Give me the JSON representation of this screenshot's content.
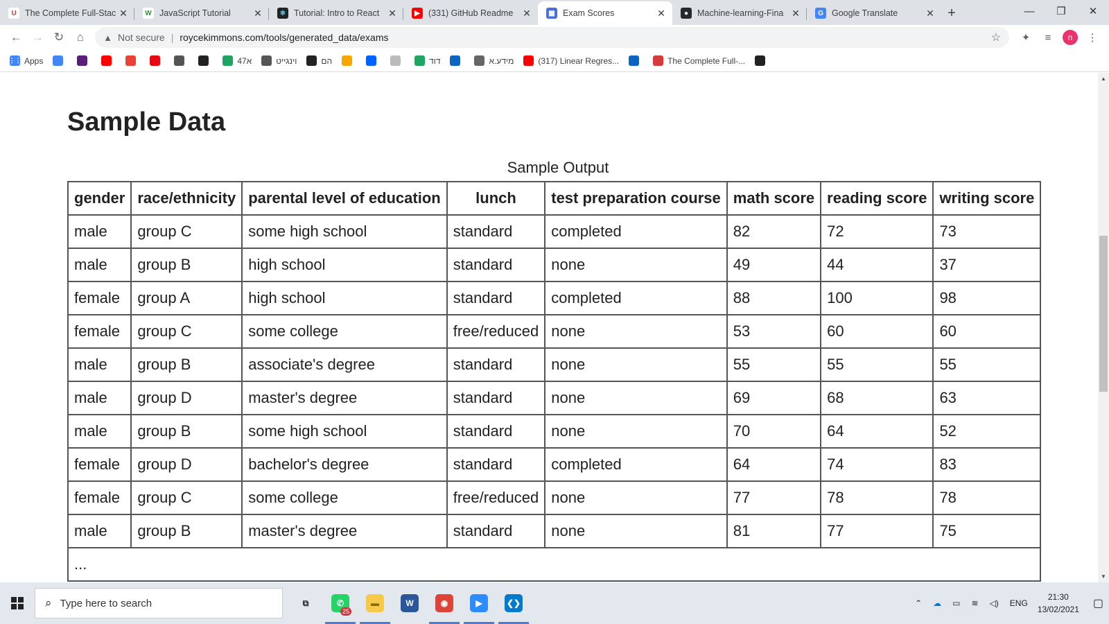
{
  "browser": {
    "tabs": [
      {
        "title": "The Complete Full-Stac",
        "fav": "U",
        "color": "#ffffff",
        "fg": "#d63c3c",
        "active": false
      },
      {
        "title": "JavaScript Tutorial",
        "fav": "W",
        "color": "#ffffff",
        "fg": "#2e8b3a",
        "active": false
      },
      {
        "title": "Tutorial: Intro to React",
        "fav": "⚛",
        "color": "#222222",
        "fg": "#61dafb",
        "active": false
      },
      {
        "title": "(331) GitHub Readme",
        "fav": "▶",
        "color": "#ff0000",
        "fg": "#ffffff",
        "active": false
      },
      {
        "title": "Exam Scores",
        "fav": "▦",
        "color": "#4a6fd6",
        "fg": "#ffffff",
        "active": true
      },
      {
        "title": "Machine-learning-Fina",
        "fav": "●",
        "color": "#24292e",
        "fg": "#ffffff",
        "active": false
      },
      {
        "title": "Google Translate",
        "fav": "G",
        "color": "#4285f4",
        "fg": "#ffffff",
        "active": false
      }
    ],
    "security_label": "Not secure",
    "url": "roycekimmons.com/tools/generated_data/exams",
    "avatar_letter": "n",
    "bookmarks": [
      {
        "label": "Apps",
        "icon": "apps-icon",
        "color": "#4285f4"
      },
      {
        "label": "",
        "icon": "translate-icon",
        "color": "#4285f4"
      },
      {
        "label": "",
        "icon": "app-icon",
        "color": "#5a1d7a"
      },
      {
        "label": "",
        "icon": "youtube-icon",
        "color": "#ff0000"
      },
      {
        "label": "",
        "icon": "google-icon",
        "color": "#ea4335"
      },
      {
        "label": "",
        "icon": "netflix-icon",
        "color": "#e50914"
      },
      {
        "label": "",
        "icon": "globe-icon",
        "color": "#555555"
      },
      {
        "label": "",
        "icon": "x-icon",
        "color": "#222222"
      },
      {
        "label": "47א",
        "icon": "drive-icon",
        "color": "#1fa463"
      },
      {
        "label": "וינגייט",
        "icon": "globe-icon",
        "color": "#555555"
      },
      {
        "label": "הם",
        "icon": "wix-icon",
        "color": "#222222"
      },
      {
        "label": "",
        "icon": "fire-icon",
        "color": "#f6a800"
      },
      {
        "label": "",
        "icon": "dropbox-icon",
        "color": "#0061ff"
      },
      {
        "label": "",
        "icon": "cloud-icon",
        "color": "#bbbbbb"
      },
      {
        "label": "דוד",
        "icon": "drive-icon",
        "color": "#1fa463"
      },
      {
        "label": "",
        "icon": "linkedin-icon",
        "color": "#0a66c2"
      },
      {
        "label": "מידע.א",
        "icon": "app-icon",
        "color": "#666666"
      },
      {
        "label": "(317) Linear Regres...",
        "icon": "youtube-icon",
        "color": "#ff0000"
      },
      {
        "label": "",
        "icon": "linkedin-icon",
        "color": "#0a66c2"
      },
      {
        "label": "The Complete Full-...",
        "icon": "udemy-icon",
        "color": "#d63c3c"
      },
      {
        "label": "",
        "icon": "github-icon",
        "color": "#222222"
      }
    ]
  },
  "page": {
    "title": "Sample Data",
    "caption": "Sample Output",
    "columns": [
      "gender",
      "race/ethnicity",
      "parental level of education",
      "lunch",
      "test preparation course",
      "math score",
      "reading score",
      "writing score"
    ],
    "rows": [
      [
        "male",
        "group C",
        "some high school",
        "standard",
        "completed",
        "82",
        "72",
        "73"
      ],
      [
        "male",
        "group B",
        "high school",
        "standard",
        "none",
        "49",
        "44",
        "37"
      ],
      [
        "female",
        "group A",
        "high school",
        "standard",
        "completed",
        "88",
        "100",
        "98"
      ],
      [
        "female",
        "group C",
        "some college",
        "free/reduced",
        "none",
        "53",
        "60",
        "60"
      ],
      [
        "male",
        "group B",
        "associate's degree",
        "standard",
        "none",
        "55",
        "55",
        "55"
      ],
      [
        "male",
        "group D",
        "master's degree",
        "standard",
        "none",
        "69",
        "68",
        "63"
      ],
      [
        "male",
        "group B",
        "some high school",
        "standard",
        "none",
        "70",
        "64",
        "52"
      ],
      [
        "female",
        "group D",
        "bachelor's degree",
        "standard",
        "completed",
        "64",
        "74",
        "83"
      ],
      [
        "female",
        "group C",
        "some college",
        "free/reduced",
        "none",
        "77",
        "78",
        "78"
      ],
      [
        "male",
        "group B",
        "master's degree",
        "standard",
        "none",
        "81",
        "77",
        "75"
      ]
    ],
    "more_rows": "..."
  },
  "taskbar": {
    "search_placeholder": "Type here to search",
    "apps": [
      {
        "name": "task-view-icon",
        "label": "⧉",
        "color": "#e3e7ee",
        "fg": "#222222",
        "running": false
      },
      {
        "name": "whatsapp-icon",
        "label": "✆",
        "color": "#25d366",
        "fg": "#ffffff",
        "running": true,
        "badge": "25"
      },
      {
        "name": "file-explorer-icon",
        "label": "▬",
        "color": "#f7c948",
        "fg": "#8a6a00",
        "running": true
      },
      {
        "name": "word-icon",
        "label": "W",
        "color": "#2b579a",
        "fg": "#ffffff",
        "running": false
      },
      {
        "name": "chrome-icon",
        "label": "◉",
        "color": "#db4437",
        "fg": "#ffffff",
        "running": true
      },
      {
        "name": "zoom-icon",
        "label": "▶",
        "color": "#2d8cff",
        "fg": "#ffffff",
        "running": true
      },
      {
        "name": "vscode-icon",
        "label": "❮❯",
        "color": "#007acc",
        "fg": "#ffffff",
        "running": true
      }
    ],
    "language": "ENG",
    "time": "21:30",
    "date": "13/02/2021"
  }
}
